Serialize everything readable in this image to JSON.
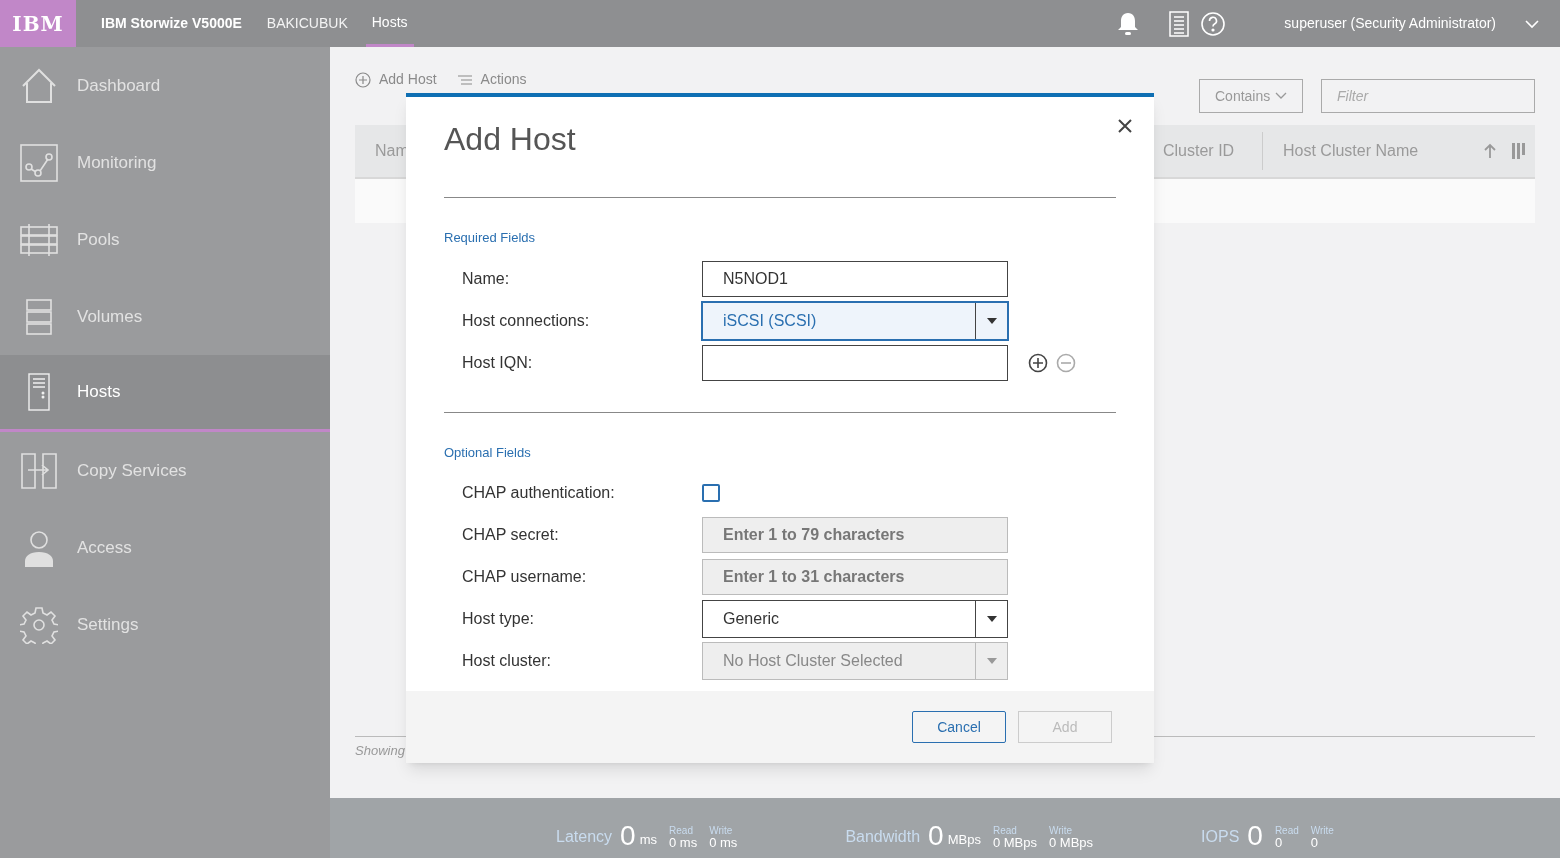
{
  "header": {
    "logo": "IBM",
    "product": "IBM Storwize V5000E",
    "system": "BAKICUBUK",
    "tabs": [
      {
        "label": "Hosts",
        "selected": true
      }
    ],
    "user": "superuser (Security Administrator)"
  },
  "sidebar": {
    "items": [
      {
        "label": "Dashboard",
        "selected": false
      },
      {
        "label": "Monitoring",
        "selected": false
      },
      {
        "label": "Pools",
        "selected": false
      },
      {
        "label": "Volumes",
        "selected": false
      },
      {
        "label": "Hosts",
        "selected": true
      },
      {
        "label": "Copy Services",
        "selected": false
      },
      {
        "label": "Access",
        "selected": false
      },
      {
        "label": "Settings",
        "selected": false
      }
    ]
  },
  "main": {
    "toolbar": [
      "Add Host",
      "Actions"
    ],
    "filter": {
      "operator": "Contains",
      "placeholder": "Filter"
    },
    "table": {
      "columns": [
        "Nam",
        "Cluster ID",
        "Host Cluster Name"
      ]
    },
    "footer": "Showing"
  },
  "dialog": {
    "title": "Add Host",
    "sections": [
      {
        "heading": "Required Fields",
        "fields": [
          {
            "kind": "text",
            "label": "Name:",
            "value": "N5NOD1",
            "disabled": false
          },
          {
            "kind": "select",
            "label": "Host connections:",
            "value": "iSCSI (SCSI)",
            "focused": true,
            "disabled": false
          },
          {
            "kind": "iqn",
            "label": "Host IQN:",
            "disabled": false
          }
        ]
      },
      {
        "heading": "Optional Fields",
        "fields": [
          {
            "kind": "checkbox",
            "label": "CHAP authentication:",
            "checked": false
          },
          {
            "kind": "text",
            "label": "CHAP secret:",
            "placeholder": "Enter 1 to 79 characters",
            "disabled": true
          },
          {
            "kind": "text",
            "label": "CHAP username:",
            "placeholder": "Enter 1 to 31 characters",
            "disabled": true
          },
          {
            "kind": "select",
            "label": "Host type:",
            "value": "Generic",
            "focused": false,
            "disabled": false
          },
          {
            "kind": "select",
            "label": "Host cluster:",
            "value": "No Host Cluster Selected",
            "focused": false,
            "disabled": true
          }
        ]
      }
    ],
    "buttons": [
      {
        "label": "Cancel",
        "disabled": false
      },
      {
        "label": "Add",
        "disabled": true
      }
    ]
  },
  "stats": [
    {
      "label": "Latency",
      "value": "0",
      "unit": "ms",
      "read_label": "Read",
      "read": "0 ms",
      "write_label": "Write",
      "write": "0 ms"
    },
    {
      "label": "Bandwidth",
      "value": "0",
      "unit": "MBps",
      "read_label": "Read",
      "read": "0 MBps",
      "write_label": "Write",
      "write": "0 MBps"
    },
    {
      "label": "IOPS",
      "value": "0",
      "read_label": "Read",
      "read": "0",
      "write_label": "Write",
      "write": "0"
    }
  ]
}
